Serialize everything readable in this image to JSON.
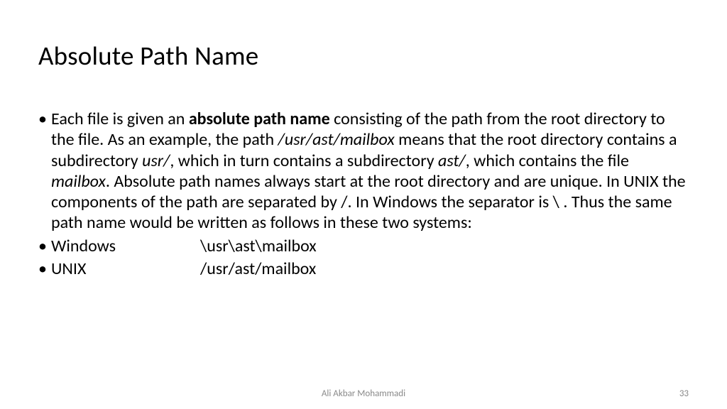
{
  "title": "Absolute Path Name",
  "b1_a": "Each file is given an ",
  "b1_b": "absolute path name",
  "b1_c": " consisting of the path from the root directory to the file. As an example, the path ",
  "b1_d": "/usr/ast/mailbox",
  "b1_e": " means that the root directory contains a subdirectory ",
  "b1_f": "usr/",
  "b1_g": ", which in turn contains a subdirectory ",
  "b1_h": "ast/",
  "b1_i": ", which contains the file ",
  "b1_j": "mailbox",
  "b1_k": ". Absolute path names always start at the root directory and are unique. In UNIX the components of the path are separated by /. In Windows the separator is \\ . Thus the same path name would be written as follows in these two systems:",
  "b2_label": "Windows",
  "b2_path": "\\usr\\ast\\mailbox",
  "b3_label": "UNIX",
  "b3_path": "/usr/ast/mailbox",
  "footer_author": "Ali Akbar Mohammadi",
  "footer_page": "33"
}
